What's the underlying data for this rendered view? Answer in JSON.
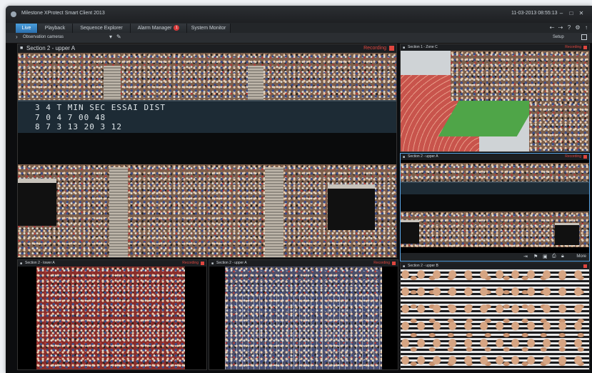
{
  "app": {
    "title": "Milestone XProtect Smart Client 2013",
    "datetime": "11-03-2013 08:55:13"
  },
  "window_controls": {
    "minimize": "–",
    "maximize": "□",
    "close": "✕"
  },
  "tabs": [
    {
      "label": "Live",
      "active": true
    },
    {
      "label": "Playback",
      "active": false
    },
    {
      "label": "Sequence Explorer",
      "active": false
    },
    {
      "label": "Alarm Manager",
      "active": false,
      "badge": "1"
    },
    {
      "label": "System Monitor",
      "active": false
    }
  ],
  "toolbar_icons": [
    "arrow-back-icon",
    "arrow-forward-icon",
    "help-icon",
    "settings-icon",
    "pin-icon"
  ],
  "viewbar": {
    "view_name": "Observation cameras",
    "setup_label": "Setup"
  },
  "tiles": [
    {
      "label": "Section 2 - upper A",
      "status": "Recording"
    },
    {
      "label": "Section 1 - Zone C",
      "status": "Recording"
    },
    {
      "label": "Section 2 - upper A",
      "status": "Recording"
    },
    {
      "label": "Section 2 - lower A",
      "status": "Recording"
    },
    {
      "label": "Section 2 - upper A",
      "status": "Recording"
    },
    {
      "label": "Section 2 - upper B",
      "status": ""
    }
  ],
  "scoreboard": {
    "top_row": "3    4     T    MIN  SEC  ESSAI   DIST",
    "row1": "7    0  4   7    00   48",
    "row2": "8    7  3  13    20    3       12"
  },
  "tile_toolbar": {
    "more_label": "More"
  },
  "colors": {
    "accent": "#2a6fae",
    "recording": "#e0463f",
    "background": "#1b1d20"
  }
}
